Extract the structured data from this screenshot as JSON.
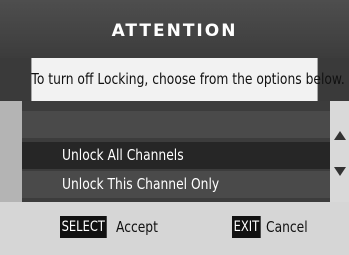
{
  "dialog": {
    "title": "ATTENTION",
    "message": "To turn off Locking, choose from the options below."
  },
  "options": [
    {
      "label": ""
    },
    {
      "label": "Unlock All Channels"
    },
    {
      "label": "Unlock This Channel Only"
    }
  ],
  "footer": {
    "select_key": "SELECT",
    "select_label": "Accept",
    "exit_key": "EXIT",
    "exit_label": "Cancel"
  },
  "icons": {
    "scroll_up": "triangle-up-icon",
    "scroll_down": "triangle-down-icon"
  },
  "colors": {
    "title_bg": "#444444",
    "message_bg": "#f2f2f2",
    "highlight_row": "#262626",
    "footer_bg": "#d6d6d6"
  }
}
